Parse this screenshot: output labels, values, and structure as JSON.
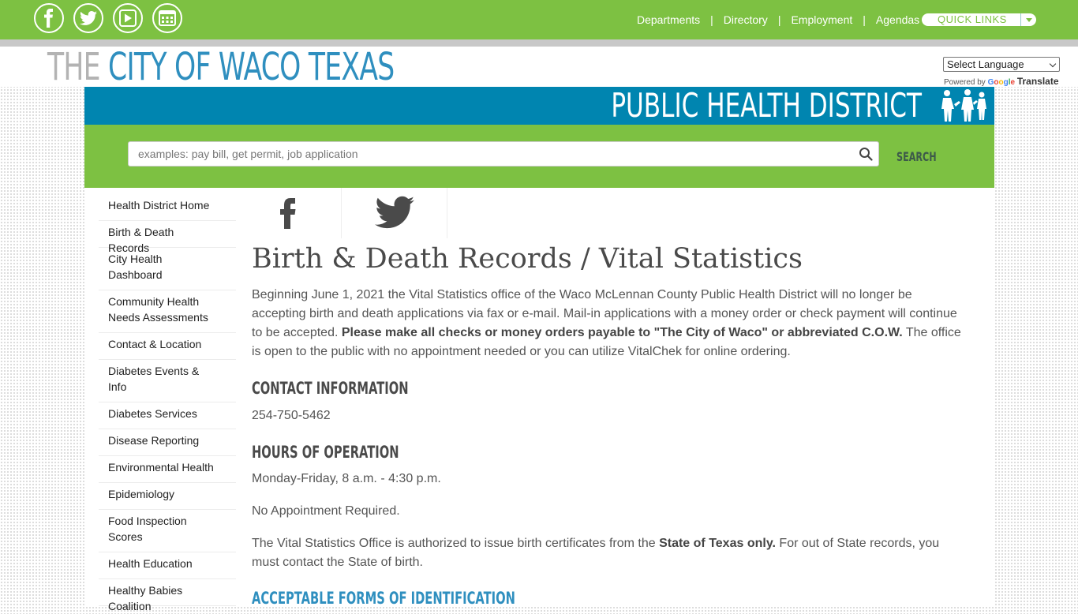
{
  "top_nav": {
    "links": [
      "Departments",
      "Directory",
      "Employment",
      "Agendas"
    ],
    "quick_links": "QUICK LINKS"
  },
  "logo": {
    "part1": "THE ",
    "part2": "CITY OF WACO TEXAS"
  },
  "translate": {
    "select_label": "Select Language",
    "powered_by": "Powered by ",
    "google": "Google",
    "translate": "Translate"
  },
  "banner": {
    "title": "PUBLIC HEALTH DISTRICT"
  },
  "search": {
    "placeholder": "examples: pay bill, get permit, job application",
    "button_label": "SEARCH"
  },
  "sidebar": {
    "items": [
      "Health District Home",
      "Birth & Death Records",
      "City Health Dashboard",
      "Community Health Needs Assessments",
      "Contact & Location",
      "Diabetes Events & Info",
      "Diabetes Services",
      "Disease Reporting",
      "Environmental Health",
      "Epidemiology",
      "Food Inspection Scores",
      "Health Education",
      "Healthy Babies Coalition"
    ]
  },
  "main": {
    "title": "Birth & Death Records / Vital Statistics",
    "intro_1": "Beginning June 1, 2021 the Vital Statistics office of the Waco McLennan County Public Health District will no longer be accepting birth and death applications via fax or e-mail.  Mail-in applications with a money order or check payment will continue to be accepted. ",
    "intro_bold": "Please make all checks or money orders payable to \"The City of Waco\" or abbreviated C.O.W.",
    "intro_2": " The office is open to the public with no appointment needed or you can utilize VitalChek for online ordering.",
    "contact_heading": "CONTACT INFORMATION",
    "phone": "254-750-5462",
    "hours_heading": "HOURS OF OPERATION",
    "hours": "Monday-Friday, 8 a.m. - 4:30 p.m.",
    "no_appointment": "No Appointment Required.",
    "authorized_1": "The Vital Statistics Office is authorized to issue birth certificates from the ",
    "authorized_bold": "State of Texas only.",
    "authorized_2": "  For out of State records, you must contact the State of birth.",
    "id_heading": "ACCEPTABLE FORMS OF IDENTIFICATION"
  },
  "colors": {
    "green": "#7dc142",
    "blue": "#0085b0",
    "heading_blue": "#2f8fbf"
  },
  "icons": [
    "facebook-icon",
    "twitter-icon",
    "video-play-icon",
    "calendar-icon",
    "search-icon",
    "people-icon"
  ]
}
